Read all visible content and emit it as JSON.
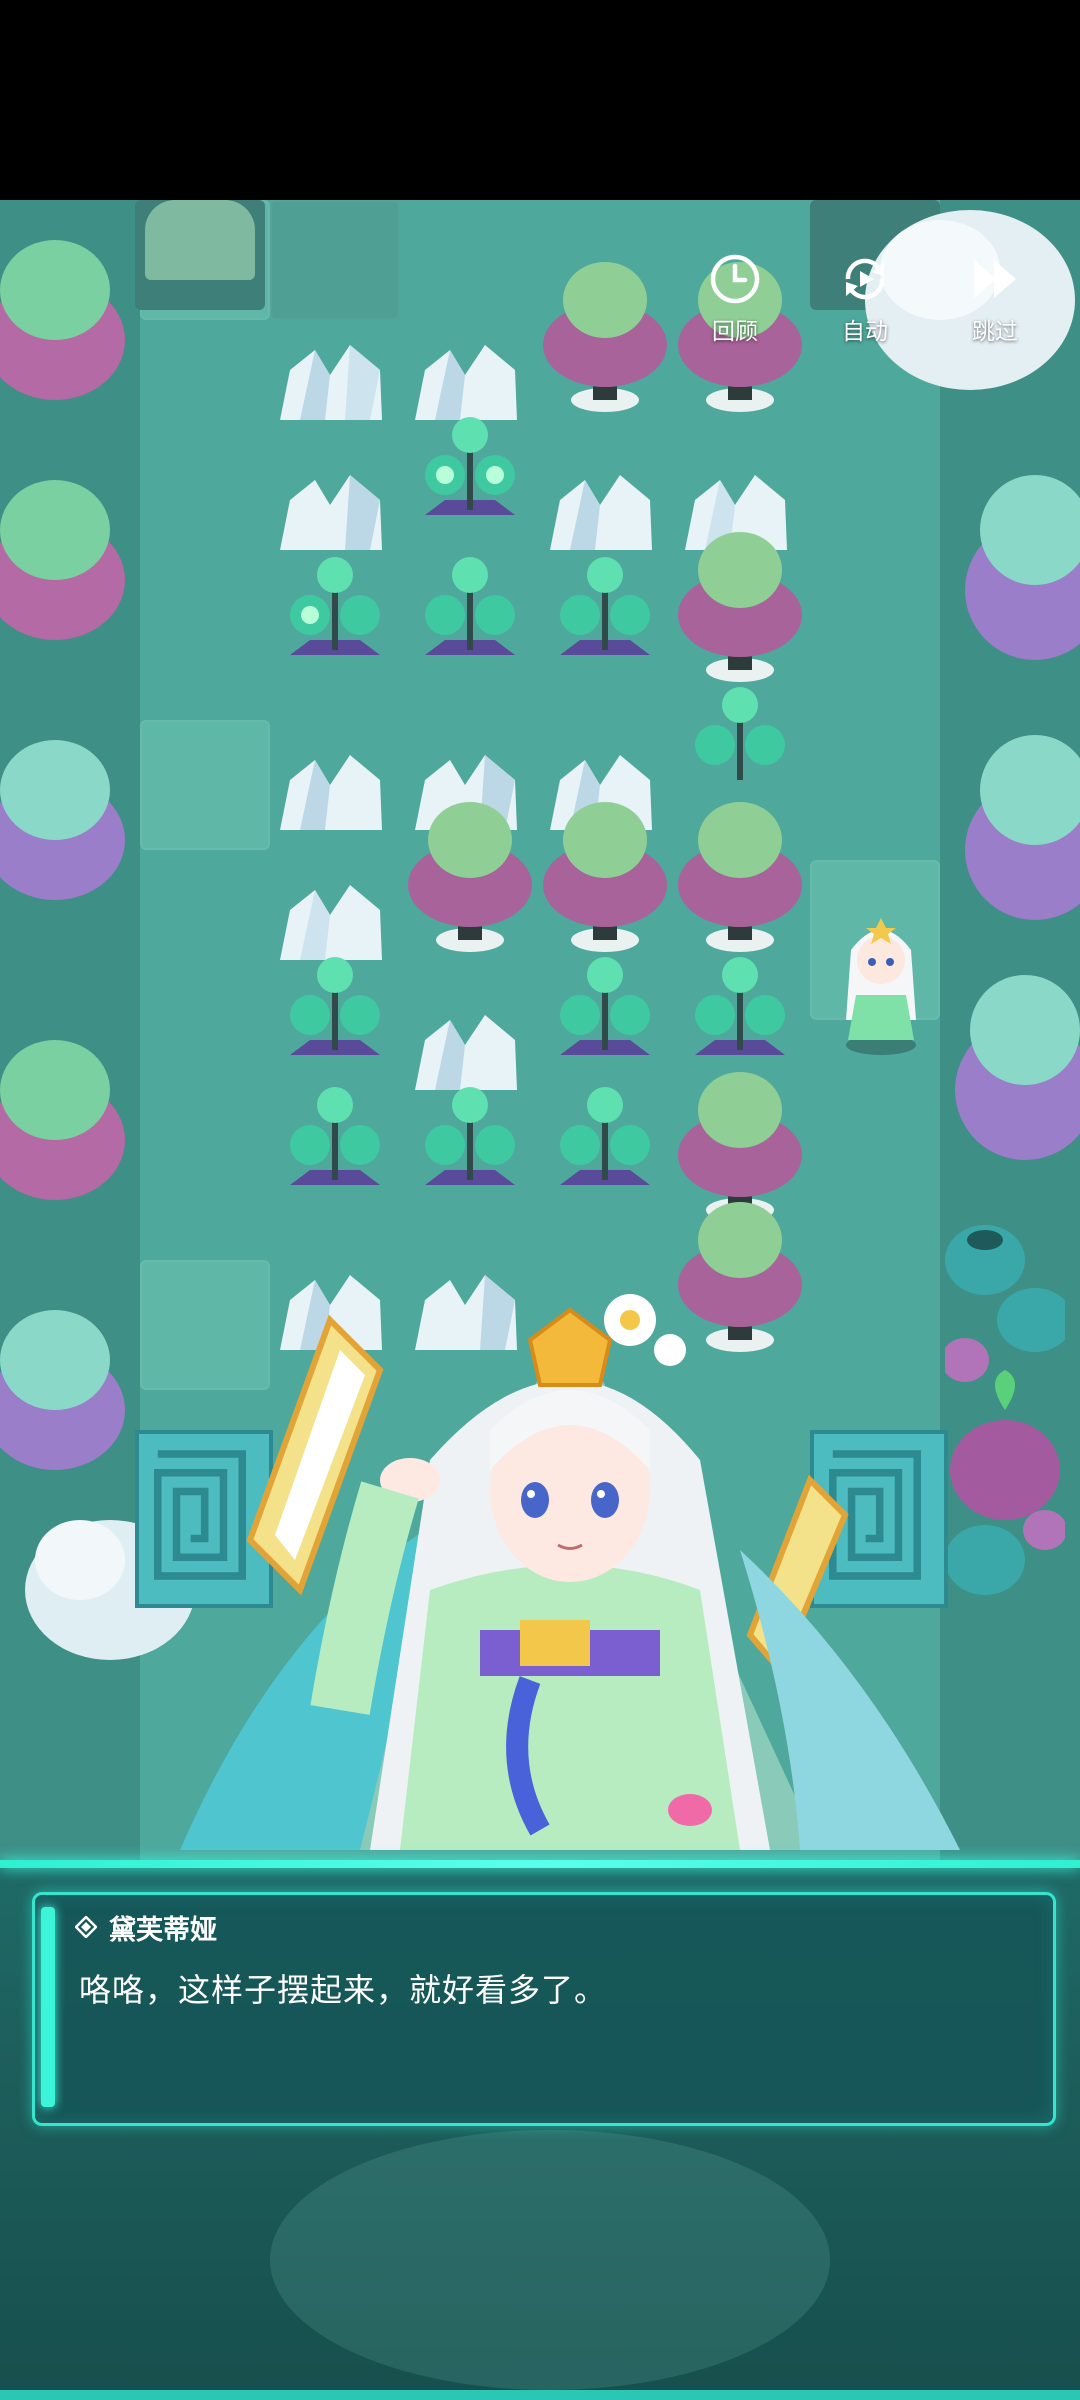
{
  "controls": {
    "review_label": "回顾",
    "auto_label": "自动",
    "skip_label": "跳过",
    "review_icon": "clock-icon",
    "auto_icon": "auto-play-icon",
    "skip_icon": "fast-forward-icon"
  },
  "dialog": {
    "speaker_icon": "diamond-icon",
    "speaker_name": "黛芙蒂娅",
    "text": "咯咯，这样子摆起来，就好看多了。"
  },
  "colors": {
    "scene_bg": "#4fa89c",
    "dialog_border": "#35e6cf",
    "dialog_bg": "#165658",
    "text": "#ffffff"
  }
}
